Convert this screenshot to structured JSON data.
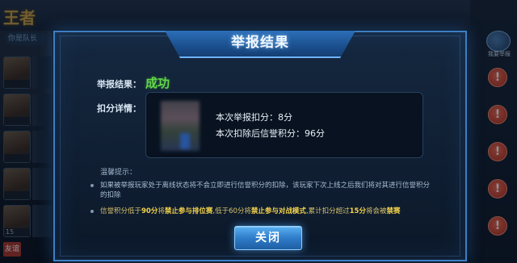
{
  "background": {
    "logo": "王者",
    "tab_label": "你是队长",
    "avatar_captions": [
      "",
      "",
      "",
      "",
      "15"
    ],
    "bottom_tab": "友谊",
    "right_rail_button": "我要举报"
  },
  "dialog": {
    "title": "举报结果",
    "result_label": "举报结果：",
    "result_value": "成功",
    "detail_label": "扣分详情：",
    "deduction_line": "本次举报扣分：8分",
    "remaining_line": "本次扣除后信誉积分：96分",
    "tips_title": "温馨提示：",
    "tip1": "如果被举报玩家处于离线状态将不会立即进行信誉积分的扣除，该玩家下次上线之后我们将对其进行信誉积分的扣除",
    "tip2_parts": {
      "p1": "信誉积分低于",
      "n1": "90分",
      "p2": "将",
      "h1": "禁止参与排位赛",
      "p3": ",低于60分将",
      "h2": "禁止参与对战模式",
      "p4": ",累计扣分超过",
      "n2": "15分",
      "p5": "将会被",
      "h3": "禁赛"
    },
    "close_button": "关闭"
  },
  "colors": {
    "success": "#63d64a",
    "accent_blue": "#3d7ec4",
    "warning_red": "#d13a28",
    "highlight_yellow": "#f5d44a"
  },
  "icons": [
    "warning-icon"
  ]
}
